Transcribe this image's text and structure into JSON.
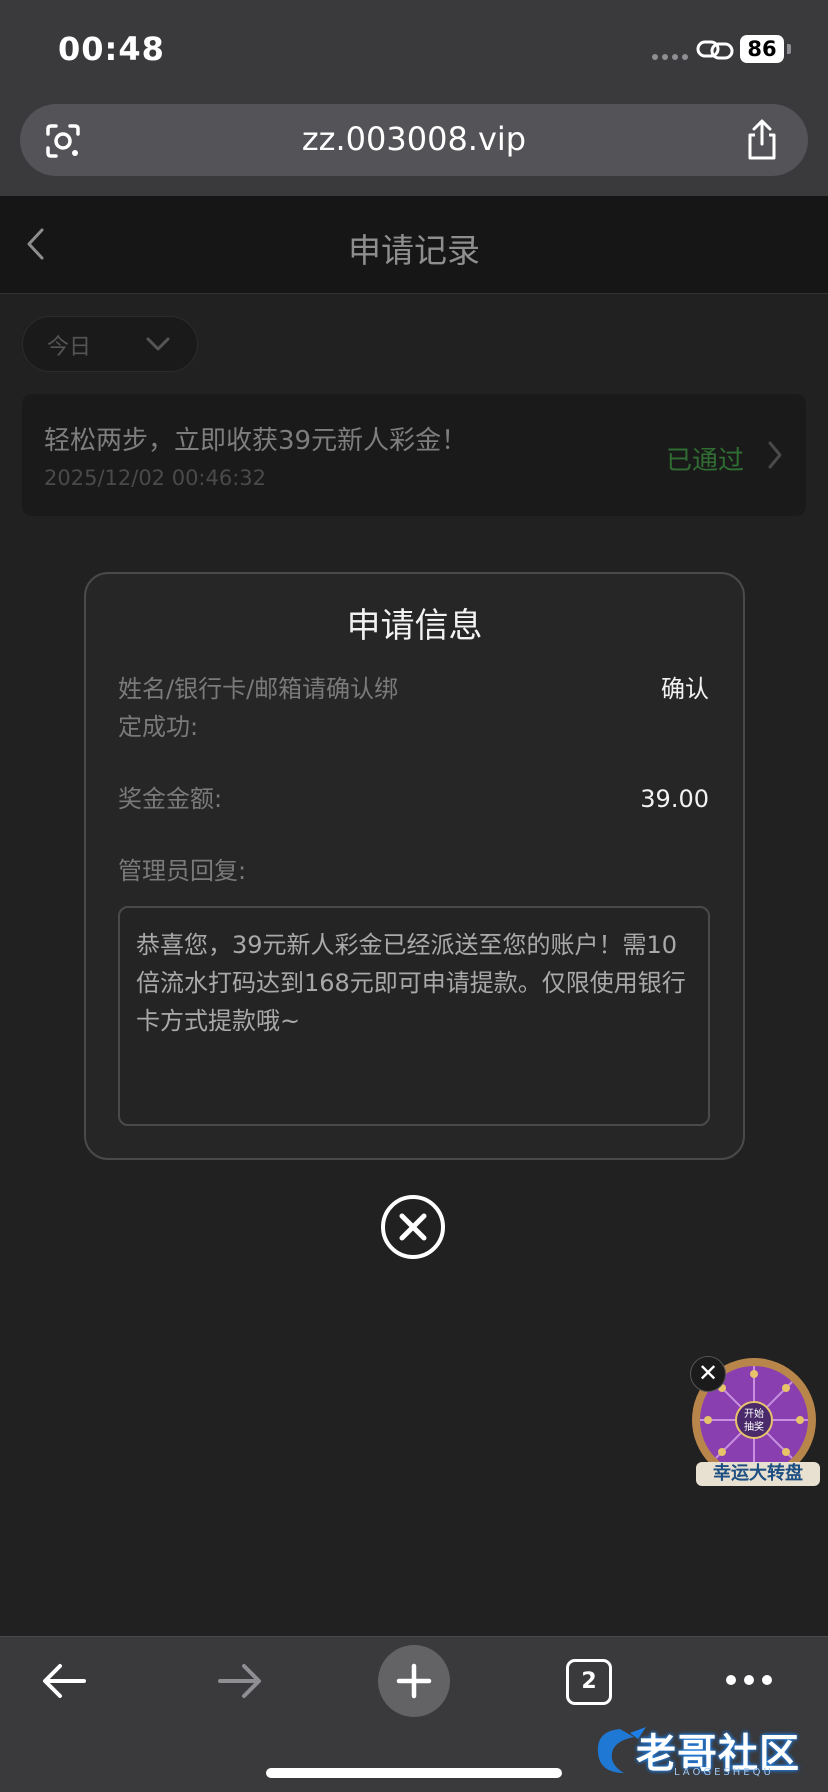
{
  "status_bar": {
    "time": "00:48",
    "battery_level": "86",
    "icons": [
      "signal-dots-icon",
      "link-icon",
      "battery-icon"
    ]
  },
  "browser": {
    "url": "zz.003008.vip",
    "icons": [
      "lens-icon",
      "share-icon"
    ]
  },
  "header": {
    "title": "申请记录",
    "icons": [
      "chevron-left-icon"
    ]
  },
  "filter": {
    "selected": "今日",
    "icons": [
      "chevron-down-icon"
    ]
  },
  "record": {
    "title": "轻松两步，立即收获39元新人彩金！",
    "date": "2025/12/02 00:46:32",
    "status": "已通过",
    "status_color": "#2f6d32",
    "icons": [
      "chevron-right-icon"
    ]
  },
  "modal": {
    "title": "申请信息",
    "rows": [
      {
        "label_line1": "姓名/银行卡/邮箱请确认绑",
        "label_line2": "定成功:",
        "value": "确认"
      },
      {
        "label": "奖金金额:",
        "value": "39.00"
      }
    ],
    "reply_label": "管理员回复:",
    "reply_text": "恭喜您，39元新人彩金已经派送至您的账户！需10倍流水打码达到168元即可申请提款。仅限使用银行卡方式提款哦~"
  },
  "overlay": {
    "icons": [
      "close-circle-icon"
    ]
  },
  "wheel_widget": {
    "close_label": "✕",
    "center_label_line1": "开始",
    "center_label_line2": "抽奖",
    "caption": "幸运大转盘",
    "wheel_color": "#8a3fb0"
  },
  "bottom_bar": {
    "tab_count": "2",
    "icons": [
      "arrow-left-icon",
      "arrow-right-icon",
      "plus-icon",
      "tabs-icon",
      "more-icon"
    ]
  },
  "watermark": {
    "text": "老哥社区",
    "subtext": "LAOGESHEQU"
  },
  "colors": {
    "page_bg": "#212121",
    "chrome_bg": "#3a3a3c",
    "header_bg": "#161616",
    "accent_green": "#2f6d32"
  }
}
